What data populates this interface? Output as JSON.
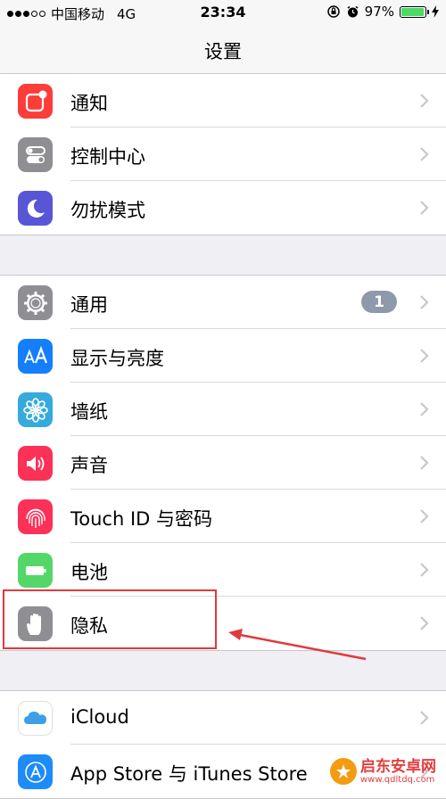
{
  "status_bar": {
    "carrier": "中国移动",
    "network": "4G",
    "time": "23:34",
    "battery_percent": "97%",
    "battery_level": 0.97
  },
  "nav": {
    "title": "设置"
  },
  "groups": [
    {
      "items": [
        {
          "label": "通知",
          "icon": "notifications-icon",
          "color": "#fc3d39"
        },
        {
          "label": "控制中心",
          "icon": "control-center-icon",
          "color": "#8e8e93"
        },
        {
          "label": "勿扰模式",
          "icon": "moon-icon",
          "color": "#5856d6"
        }
      ]
    },
    {
      "items": [
        {
          "label": "通用",
          "icon": "gear-icon",
          "color": "#8e8e93",
          "badge": "1"
        },
        {
          "label": "显示与亮度",
          "icon": "display-brightness-icon",
          "color": "#147efb"
        },
        {
          "label": "墙纸",
          "icon": "wallpaper-icon",
          "color": "#35aadc"
        },
        {
          "label": "声音",
          "icon": "speaker-icon",
          "color": "#fc3158"
        },
        {
          "label": "Touch ID 与密码",
          "icon": "fingerprint-icon",
          "color": "#fc3158"
        },
        {
          "label": "电池",
          "icon": "battery-icon",
          "color": "#53d769"
        },
        {
          "label": "隐私",
          "icon": "hand-icon",
          "color": "#8e8e93"
        }
      ]
    },
    {
      "items": [
        {
          "label": "iCloud",
          "icon": "icloud-icon",
          "color": "#ffffff"
        },
        {
          "label": "App Store 与 iTunes Store",
          "icon": "app-store-icon",
          "color": "#1d8cf8"
        }
      ]
    }
  ],
  "watermark": {
    "name": "启东安卓网",
    "url": "www.qdltdq.com"
  }
}
